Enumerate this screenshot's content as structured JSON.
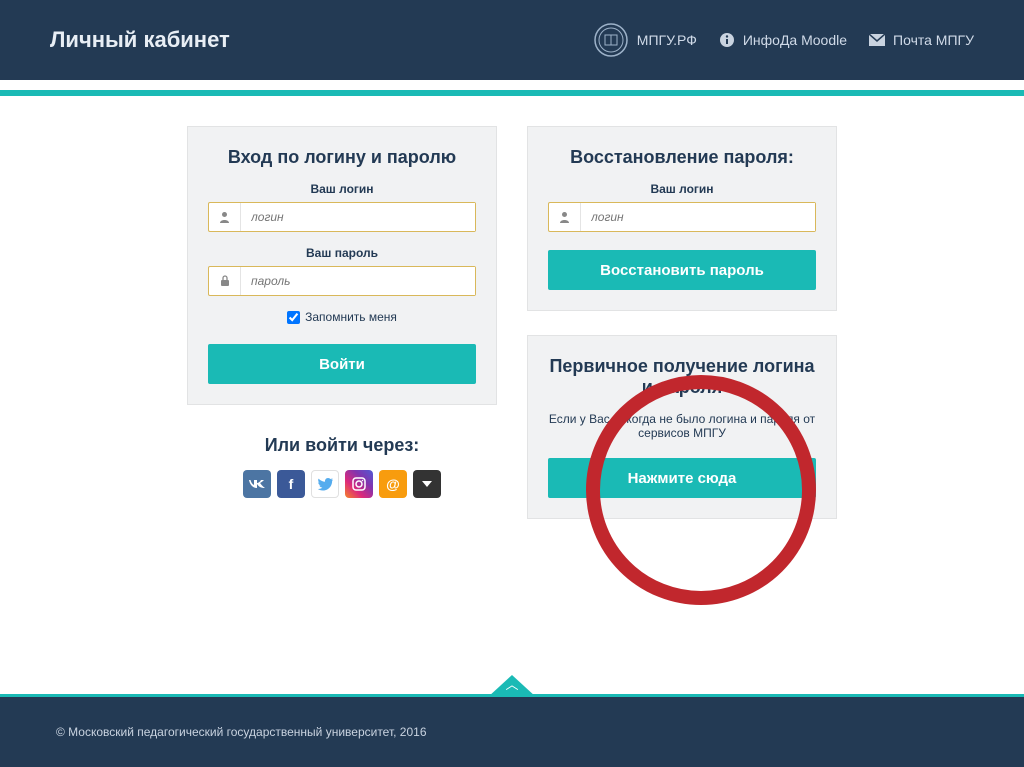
{
  "header": {
    "title": "Личный кабинет",
    "nav": {
      "site": "МПГУ.РФ",
      "moodle": "ИнфоДа Moodle",
      "mail": "Почта МПГУ"
    }
  },
  "login": {
    "title": "Вход по логину и паролю",
    "login_label": "Ваш логин",
    "login_placeholder": "логин",
    "password_label": "Ваш пароль",
    "password_placeholder": "пароль",
    "remember": "Запомнить меня",
    "submit": "Войти"
  },
  "alt_login": {
    "title": "Или войти через:"
  },
  "recovery": {
    "title": "Восстановление пароля:",
    "login_label": "Ваш логин",
    "login_placeholder": "логин",
    "submit": "Восстановить пароль"
  },
  "first_time": {
    "title": "Первичное получение логина и пароля",
    "subtitle": "Если у Вас никогда не было логина и пароля от сервисов МПГУ",
    "button": "Нажмите сюда"
  },
  "footer": {
    "copyright": "© Московский педагогический государственный университет, 2016"
  }
}
